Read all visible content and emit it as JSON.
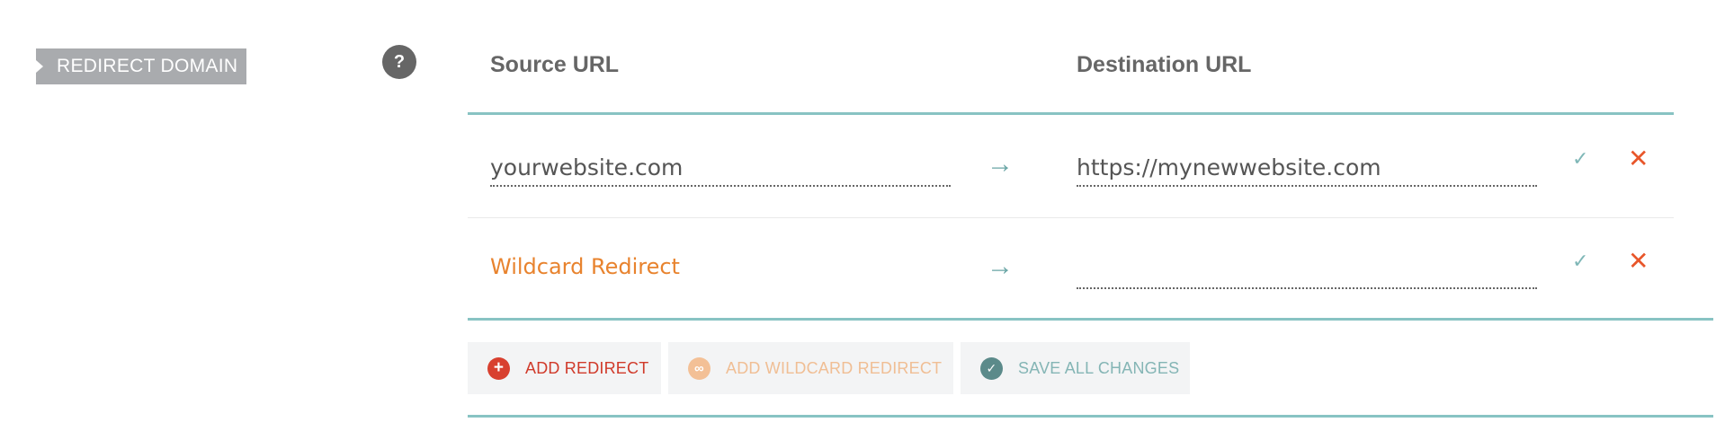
{
  "section": {
    "label": "REDIRECT DOMAIN",
    "help_icon": "?"
  },
  "table": {
    "source_header": "Source URL",
    "destination_header": "Destination URL",
    "rows": [
      {
        "source": "yourwebsite.com",
        "arrow": "→",
        "destination": "https://mynewwebsite.com",
        "confirm": "✓",
        "remove": "✕"
      },
      {
        "source": "Wildcard Redirect",
        "arrow": "→",
        "destination": "",
        "confirm": "✓",
        "remove": "✕"
      }
    ]
  },
  "actions": {
    "add_redirect": "ADD REDIRECT",
    "add_wildcard": "ADD WILDCARD REDIRECT",
    "save_all": "SAVE ALL CHANGES",
    "add_icon": "+",
    "wildcard_icon": "∞",
    "save_icon": "✓"
  },
  "colors": {
    "accent_teal": "#88c3c3",
    "wildcard_orange": "#e8832e",
    "delete_red": "#e8562a",
    "add_red": "#d8402f"
  }
}
